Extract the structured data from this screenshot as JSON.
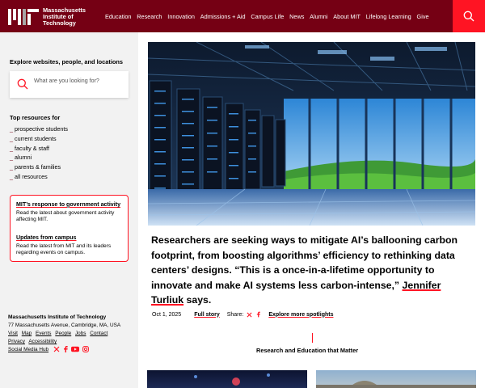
{
  "header": {
    "logo_line1": "Massachusetts",
    "logo_line2": "Institute of",
    "logo_line3": "Technology",
    "nav": [
      "Education",
      "Research",
      "Innovation",
      "Admissions + Aid",
      "Campus Life",
      "News",
      "Alumni",
      "About MIT",
      "Lifelong Learning",
      "Give"
    ],
    "search_icon": "search-icon"
  },
  "sidebar": {
    "explore_heading": "Explore websites, people, and locations",
    "search_placeholder": "What are you looking for?",
    "resources_heading": "Top resources for",
    "resources": [
      "prospective students",
      "current students",
      "faculty & staff",
      "alumni",
      "parents & families",
      "all resources"
    ],
    "notice1_title": "MIT’s response to government activity",
    "notice1_body": "Read the latest about government activity affecting MIT.",
    "notice2_title": "Updates from campus",
    "notice2_body": "Read the latest from MIT and its leaders regarding events on campus."
  },
  "footer": {
    "name": "Massachusetts Institute of Technology",
    "address": "77 Massachusetts Avenue, Cambridge, MA, USA",
    "links": [
      "Visit",
      "Map",
      "Events",
      "People",
      "Jobs",
      "Contact"
    ],
    "links2": [
      "Privacy",
      "Accessibility"
    ],
    "social_label": "Social Media Hub",
    "social_icons": [
      "x-icon",
      "facebook-icon",
      "youtube-icon",
      "instagram-icon"
    ]
  },
  "main": {
    "headline_part1": "Researchers are seeking ways to mitigate AI’s ballooning carbon footprint, from boosting algorithms’ efficiency to rethinking data centers’ designs. “This is a once-in-a-lifetime opportunity to innovate and make AI systems less carbon-intense,”",
    "headline_person": "Jennifer Turliuk",
    "headline_part2": "says.",
    "date": "Oct 1, 2025",
    "full_story": "Full story",
    "share_label": "Share:",
    "explore_more": "Explore more spotlights",
    "section_title": "Research and Education that Matter"
  },
  "colors": {
    "brand_dark": "#750014",
    "brand_bright": "#ff1423"
  }
}
